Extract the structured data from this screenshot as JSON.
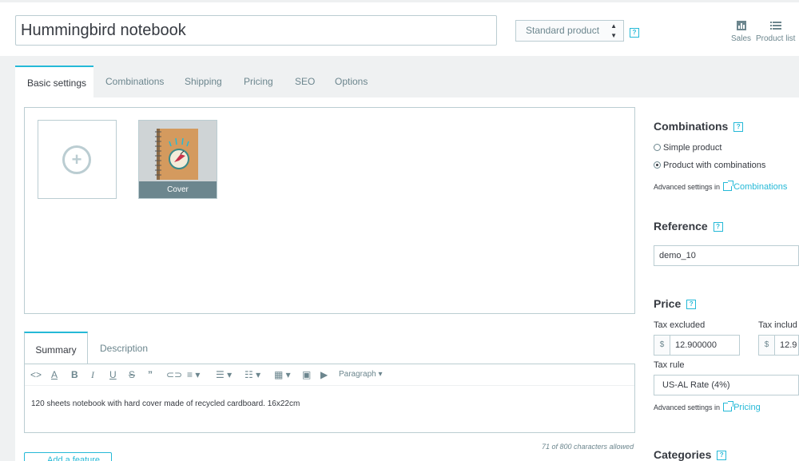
{
  "header": {
    "product_name": "Hummingbird notebook",
    "product_type": "Standard product",
    "help_icon": "help-icon",
    "actions": [
      {
        "label": "Sales",
        "icon": "bar-chart-icon"
      },
      {
        "label": "Product list",
        "icon": "list-icon"
      }
    ]
  },
  "tabs": [
    "Basic settings",
    "Combinations",
    "Shipping",
    "Pricing",
    "SEO",
    "Options"
  ],
  "images": {
    "cover_label": "Cover"
  },
  "editor": {
    "tabs": [
      "Summary",
      "Description"
    ],
    "paragraph_label": "Paragraph",
    "summary_text": "120 sheets notebook with hard cover made of recycled cardboard. 16x22cm",
    "char_count": "71 of 800 characters allowed",
    "add_feature_label": "Add a feature"
  },
  "side": {
    "combinations": {
      "heading": "Combinations",
      "options": [
        "Simple product",
        "Product with combinations"
      ],
      "selected": 1,
      "advanced_prefix": "Advanced settings in",
      "advanced_link": "Combinations"
    },
    "reference": {
      "heading": "Reference",
      "value": "demo_10"
    },
    "price": {
      "heading": "Price",
      "tax_excluded_label": "Tax excluded",
      "tax_included_label": "Tax includ",
      "currency": "$",
      "tax_excluded_value": "12.900000",
      "tax_included_value": "12.9",
      "tax_rule_label": "Tax rule",
      "tax_rule_value": "US-AL Rate (4%)",
      "advanced_prefix": "Advanced settings in",
      "advanced_link": "Pricing"
    },
    "categories": {
      "heading": "Categories"
    }
  },
  "colors": {
    "accent": "#25b9d7",
    "border": "#bbcdd2",
    "text": "#363a41",
    "muted": "#6c868e",
    "background": "#eff1f2"
  }
}
